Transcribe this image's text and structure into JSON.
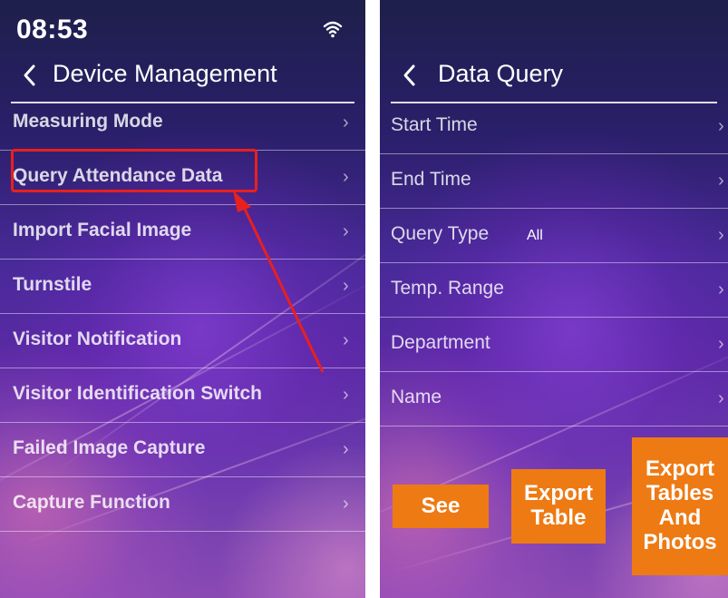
{
  "left_screen": {
    "status": {
      "time": "08:53",
      "wifi_icon": "wifi-icon"
    },
    "header": {
      "back_icon": "back-chevron-icon",
      "title": "Device Management"
    },
    "menu": [
      {
        "label": "Measuring Mode"
      },
      {
        "label": "Query Attendance Data",
        "highlighted": true
      },
      {
        "label": "Import Facial Image"
      },
      {
        "label": "Turnstile"
      },
      {
        "label": "Visitor Notification"
      },
      {
        "label": "Visitor Identification Switch"
      },
      {
        "label": "Failed Image Capture"
      },
      {
        "label": "Capture Function"
      }
    ],
    "annotation_color": "#e8201e"
  },
  "right_screen": {
    "header": {
      "back_icon": "back-chevron-icon",
      "title": "Data Query"
    },
    "menu": [
      {
        "label": "Start Time"
      },
      {
        "label": "End Time"
      },
      {
        "label": "Query Type",
        "value": "All"
      },
      {
        "label": "Temp. Range"
      },
      {
        "label": "Department"
      },
      {
        "label": "Name"
      }
    ],
    "buttons": {
      "see": "See",
      "export_table": "Export Table",
      "export_tables_photos": "Export Tables And Photos"
    },
    "button_color": "#ee7a14"
  }
}
